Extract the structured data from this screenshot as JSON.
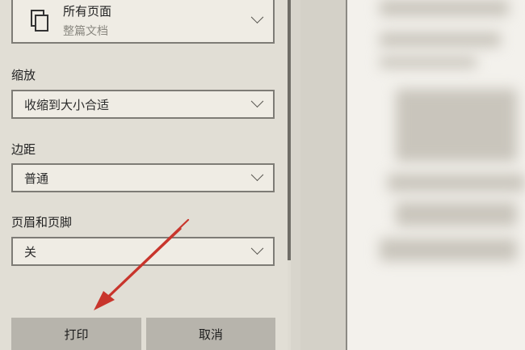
{
  "pages": {
    "value": "所有页面",
    "sub_value": "整篇文档",
    "icon": "pages-icon"
  },
  "scale": {
    "label": "缩放",
    "value": "收缩到大小合适"
  },
  "margins": {
    "label": "边距",
    "value": "普通"
  },
  "header_footer": {
    "label": "页眉和页脚",
    "value": "关"
  },
  "buttons": {
    "print": "打印",
    "cancel": "取消"
  },
  "colors": {
    "annotation_arrow": "#c8352c",
    "button_bg": "#b7b4ac"
  }
}
